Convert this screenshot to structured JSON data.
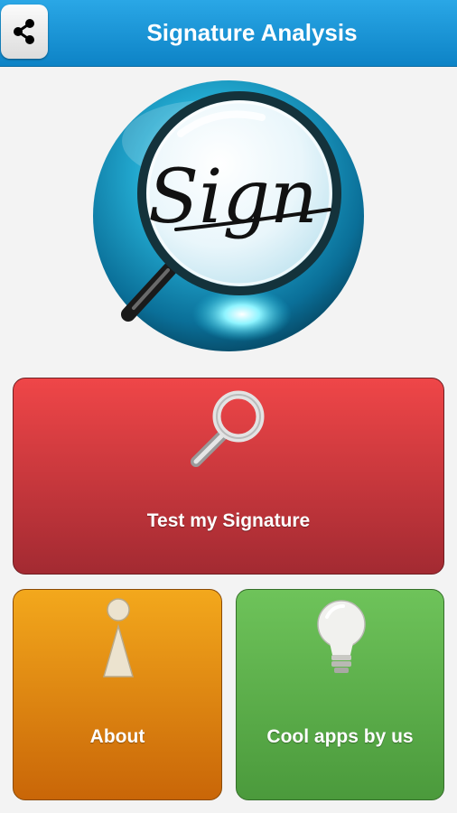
{
  "header": {
    "title": "Signature Analysis",
    "share_icon": "share-icon",
    "color": "#1a96d8"
  },
  "logo": {
    "text": "Sign",
    "icon": "magnifying-glass-logo"
  },
  "tiles": [
    {
      "label": "Test my Signature",
      "icon": "magnifier-icon",
      "color": "#d63b40"
    },
    {
      "label": "About",
      "icon": "info-icon",
      "color": "#e58a12"
    },
    {
      "label": "Cool apps by us",
      "icon": "lightbulb-icon",
      "color": "#5db04b"
    }
  ]
}
